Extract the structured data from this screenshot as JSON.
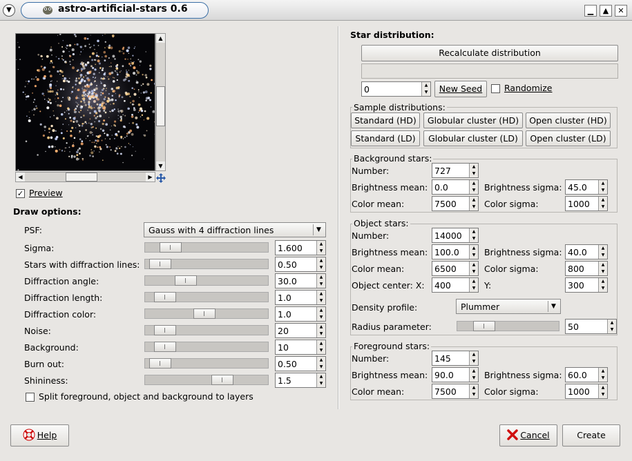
{
  "window": {
    "title": "astro-artificial-stars 0.6",
    "menu_icon": "chevron-down-icon",
    "app_icon": "gimp-icon",
    "controls": [
      "minimize-icon",
      "maximize-icon",
      "close-icon"
    ]
  },
  "preview": {
    "checkbox_label": "Preview",
    "checked": true,
    "navigate_icon": "move-icon"
  },
  "draw_options": {
    "heading": "Draw options:",
    "psf_label": "PSF:",
    "psf_value": "Gauss with 4 diffraction lines",
    "rows": [
      {
        "label": "Sigma:",
        "value": "1.600",
        "level": 0.14
      },
      {
        "label": "Stars with diffraction lines:",
        "value": "0.50",
        "level": 0.04
      },
      {
        "label": "Diffraction angle:",
        "value": "30.0",
        "level": 0.29
      },
      {
        "label": "Diffraction length:",
        "value": "1.0",
        "level": 0.09
      },
      {
        "label": "Diffraction color:",
        "value": "1.0",
        "level": 0.47
      },
      {
        "label": "Noise:",
        "value": "20",
        "level": 0.09
      },
      {
        "label": "Background:",
        "value": "10",
        "level": 0.09
      },
      {
        "label": "Burn out:",
        "value": "0.50",
        "level": 0.04
      },
      {
        "label": "Shininess:",
        "value": "1.5",
        "level": 0.65
      }
    ],
    "split_label": "Split foreground, object and background to layers",
    "split_checked": false
  },
  "star_distribution": {
    "heading": "Star distribution:",
    "recalc_label": "Recalculate distribution",
    "seed_value": "0",
    "new_seed_label": "New Seed",
    "randomize_label": "Randomize",
    "randomize_checked": false
  },
  "sample_distributions": {
    "title": "Sample distributions:",
    "buttons": [
      "Standard (HD)",
      "Globular cluster (HD)",
      "Open cluster (HD)",
      "Standard (LD)",
      "Globular cluster (LD)",
      "Open cluster (LD)"
    ]
  },
  "background_stars": {
    "title": "Background stars:",
    "number_label": "Number:",
    "number": "727",
    "bmean_label": "Brightness mean:",
    "bmean": "0.0",
    "bsigma_label": "Brightness sigma:",
    "bsigma": "45.0",
    "cmean_label": "Color mean:",
    "cmean": "7500",
    "csigma_label": "Color sigma:",
    "csigma": "1000"
  },
  "object_stars": {
    "title": "Object stars:",
    "number_label": "Number:",
    "number": "14000",
    "bmean_label": "Brightness mean:",
    "bmean": "100.0",
    "bsigma_label": "Brightness sigma:",
    "bsigma": "40.0",
    "cmean_label": "Color mean:",
    "cmean": "6500",
    "csigma_label": "Color sigma:",
    "csigma": "800",
    "center_label": "Object center: X:",
    "center_x": "400",
    "y_label": "Y:",
    "center_y": "300",
    "density_label": "Density profile:",
    "density_value": "Plummer",
    "radius_label": "Radius parameter:",
    "radius_value": "50",
    "radius_level": 0.2
  },
  "foreground_stars": {
    "title": "Foreground stars:",
    "number_label": "Number:",
    "number": "145",
    "bmean_label": "Brightness mean:",
    "bmean": "90.0",
    "bsigma_label": "Brightness sigma:",
    "bsigma": "60.0",
    "cmean_label": "Color mean:",
    "cmean": "7500",
    "csigma_label": "Color sigma:",
    "csigma": "1000"
  },
  "footer": {
    "help_label": "Help",
    "help_icon": "lifebuoy-icon",
    "cancel_label": "Cancel",
    "cancel_icon": "cancel-x-icon",
    "create_label": "Create"
  }
}
